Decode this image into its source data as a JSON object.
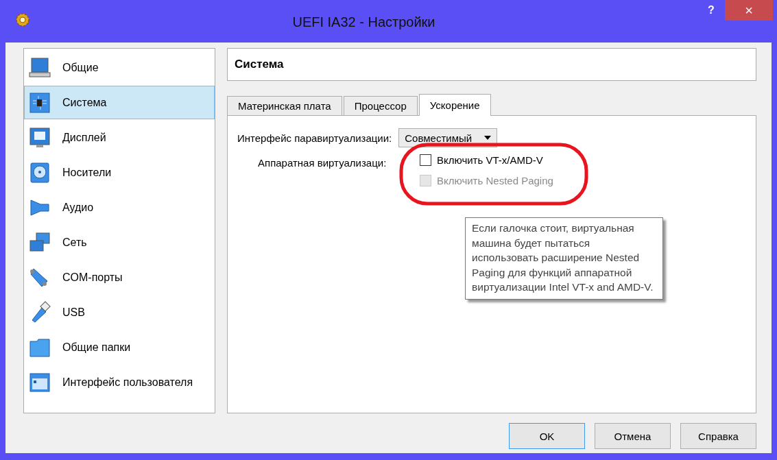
{
  "window": {
    "title": "UEFI IA32 - Настройки",
    "help_button": "?",
    "close_button": "×"
  },
  "sidebar": {
    "items": [
      {
        "label": "Общие",
        "selected": false
      },
      {
        "label": "Система",
        "selected": true
      },
      {
        "label": "Дисплей",
        "selected": false
      },
      {
        "label": "Носители",
        "selected": false
      },
      {
        "label": "Аудио",
        "selected": false
      },
      {
        "label": "Сеть",
        "selected": false
      },
      {
        "label": "COM-порты",
        "selected": false
      },
      {
        "label": "USB",
        "selected": false
      },
      {
        "label": "Общие папки",
        "selected": false
      },
      {
        "label": "Интерфейс пользователя",
        "selected": false
      }
    ]
  },
  "page_title": "Система",
  "tabs": [
    {
      "label": "Материнская плата",
      "selected": false
    },
    {
      "label": "Процессор",
      "selected": false
    },
    {
      "label": "Ускорение",
      "selected": true
    }
  ],
  "paravirt": {
    "label": "Интерфейс паравиртуализации:",
    "value": "Совместимый"
  },
  "hw_virt": {
    "label": "Аппаратная виртуализаци:",
    "options": [
      {
        "label": "Включить VT-x/AMD-V",
        "checked": false,
        "disabled": false
      },
      {
        "label": "Включить  Nested Paging",
        "checked": false,
        "disabled": true
      }
    ]
  },
  "tooltip": "Если галочка стоит, виртуальная машина будет пытаться использовать расширение Nested Paging для функций аппаратной виртуализации Intel VT-x and AMD-V.",
  "buttons": [
    {
      "label": "OK",
      "default": true
    },
    {
      "label": "Отмена",
      "default": false
    },
    {
      "label": "Справка",
      "default": false
    }
  ]
}
